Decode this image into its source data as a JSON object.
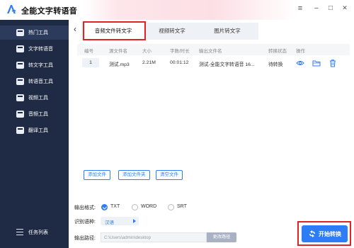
{
  "app": {
    "title": "全能文字转语音"
  },
  "window_controls": {
    "menu": "≡",
    "minimize": "−",
    "maximize": "□",
    "close": "✕"
  },
  "sidebar": {
    "items": [
      {
        "label": "热门工具",
        "icon": "grid-icon",
        "active": true
      },
      {
        "label": "文字转语音",
        "icon": "text-to-speech-icon",
        "active": false
      },
      {
        "label": "转文字工具",
        "icon": "convert-text-icon",
        "active": false
      },
      {
        "label": "转语音工具",
        "icon": "convert-voice-icon",
        "active": false
      },
      {
        "label": "视频工具",
        "icon": "video-icon",
        "active": false
      },
      {
        "label": "音频工具",
        "icon": "audio-icon",
        "active": false
      },
      {
        "label": "翻译工具",
        "icon": "translate-icon",
        "active": false
      }
    ],
    "task_list": "任务列表"
  },
  "tabs": [
    {
      "label": "音频文件转文字",
      "active": true
    },
    {
      "label": "视频转文字",
      "active": false
    },
    {
      "label": "图片转文字",
      "active": false
    }
  ],
  "table": {
    "headers": [
      "编号",
      "源文件名",
      "大小",
      "字数/时长",
      "输出文件名",
      "转换状态",
      "操作"
    ],
    "rows": [
      {
        "index": "1",
        "source": "测试.mp3",
        "size": "2.21M",
        "duration": "00:01:12",
        "output": "测试-全能文字转语音 16...",
        "status": "待转换"
      }
    ],
    "action_icons": [
      "eye-icon",
      "folder-icon",
      "trash-icon"
    ]
  },
  "buttons": {
    "add_file": "添加文件",
    "add_folder": "添加文件夹",
    "clear_files": "清空文件"
  },
  "output": {
    "format_label": "输出格式:",
    "formats": [
      {
        "label": "TXT",
        "selected": true
      },
      {
        "label": "WORD",
        "selected": false
      },
      {
        "label": "SRT",
        "selected": false
      }
    ],
    "language_label": "识别语种:",
    "language_value": "汉语",
    "path_label": "输出路径:",
    "path_value": "C:\\Users\\admin\\desktop",
    "change_path": "更改路径"
  },
  "start_button": "开始转换",
  "colors": {
    "accent": "#2f7df6",
    "sidebar_bg": "#1f2a44",
    "highlight": "#e02424"
  }
}
